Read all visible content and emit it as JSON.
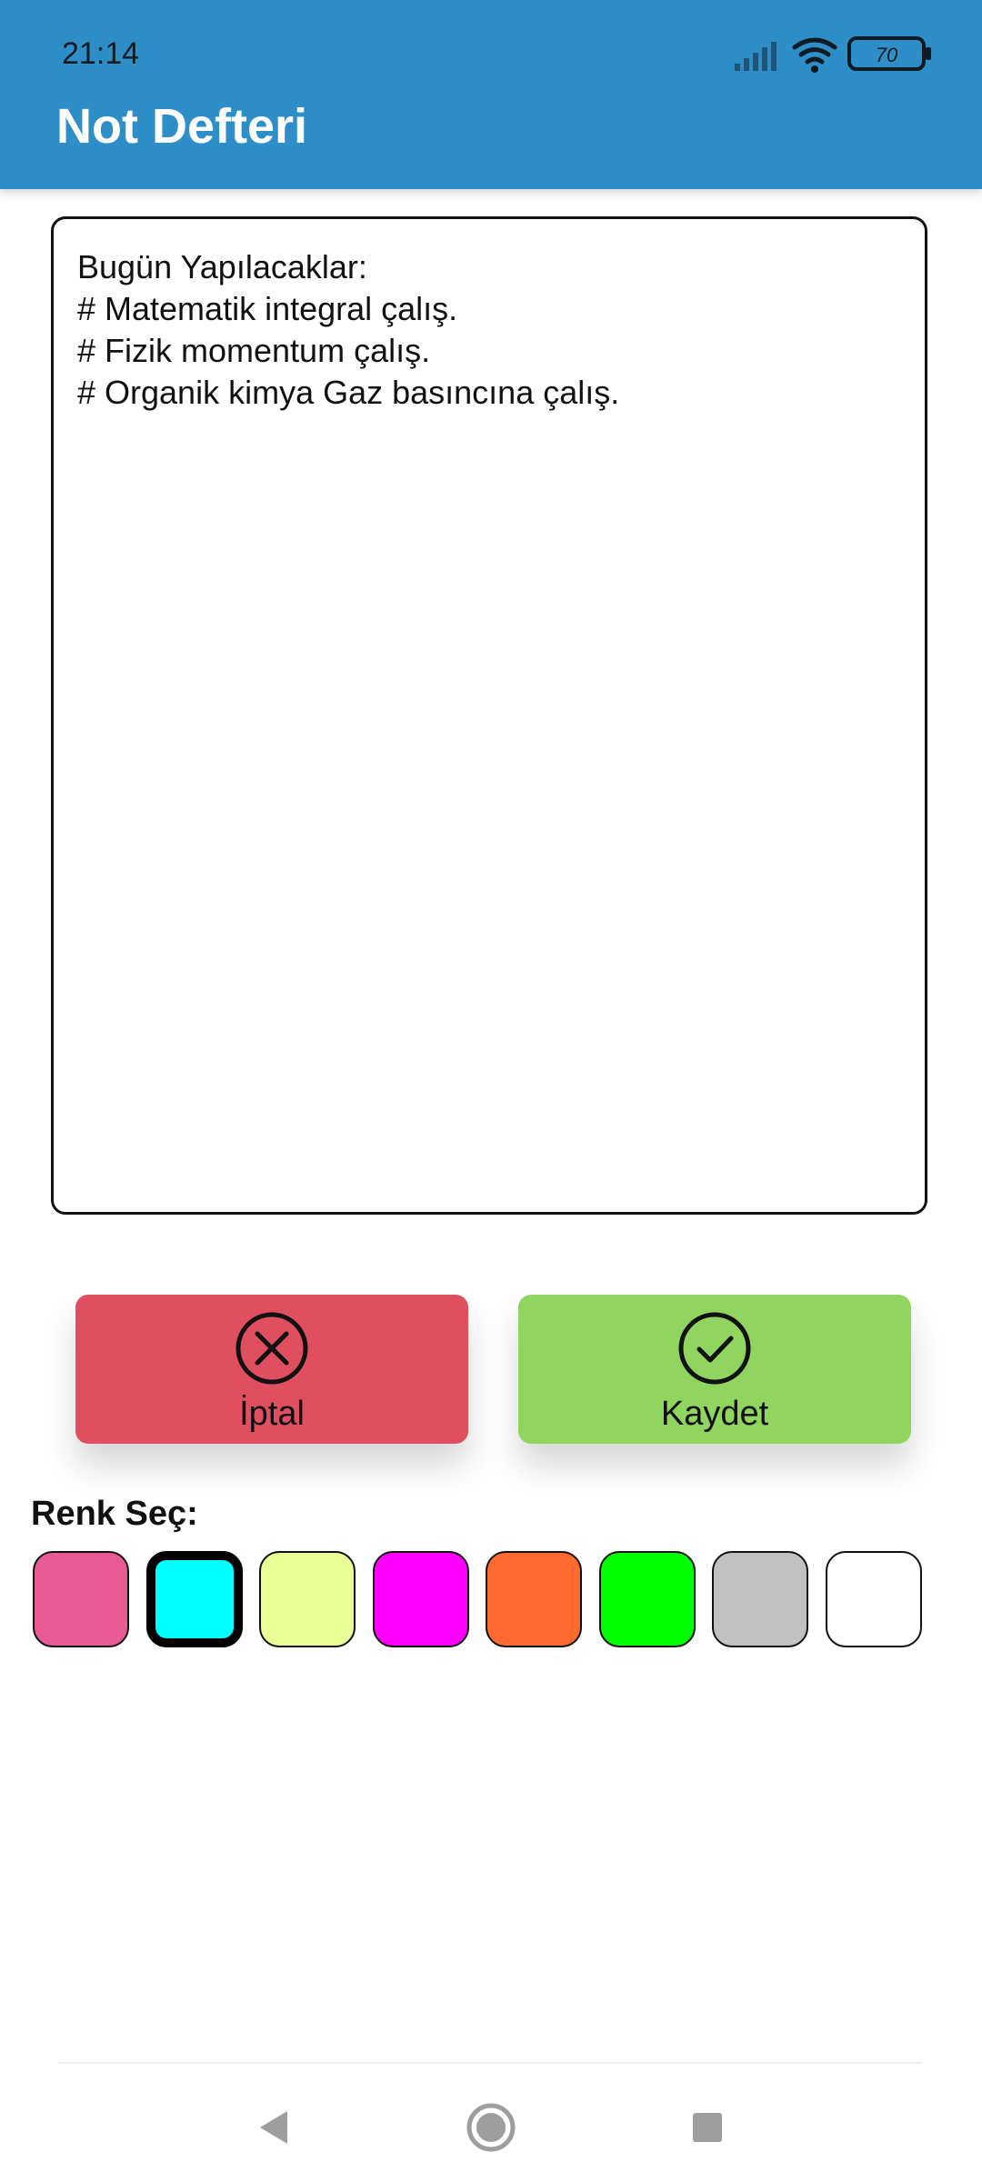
{
  "status_bar": {
    "time": "21:14",
    "battery": "70"
  },
  "app": {
    "title": "Not Defteri"
  },
  "note": {
    "text": "Bugün Yapılacaklar:\n# Matematik integral çalış.\n# Fizik momentum çalış.\n# Organik kimya Gaz basıncına çalış."
  },
  "actions": {
    "cancel": {
      "label": "İptal",
      "icon": "close-circle-icon",
      "color": "#e04f60"
    },
    "save": {
      "label": "Kaydet",
      "icon": "check-circle-icon",
      "color": "#8fd560"
    }
  },
  "color_picker": {
    "title": "Renk Seç:",
    "colors": [
      "#e85a94",
      "#00ffff",
      "#eaff96",
      "#ff00ff",
      "#ff6a2e",
      "#00ff00",
      "#c0c0c0",
      "#ffffff"
    ],
    "selected_index": 1
  },
  "nav": {
    "back_icon": "back-triangle-icon",
    "home_icon": "home-circle-icon",
    "recents_icon": "recents-square-icon"
  },
  "theme": {
    "app_bar": "#2e8fc8"
  }
}
